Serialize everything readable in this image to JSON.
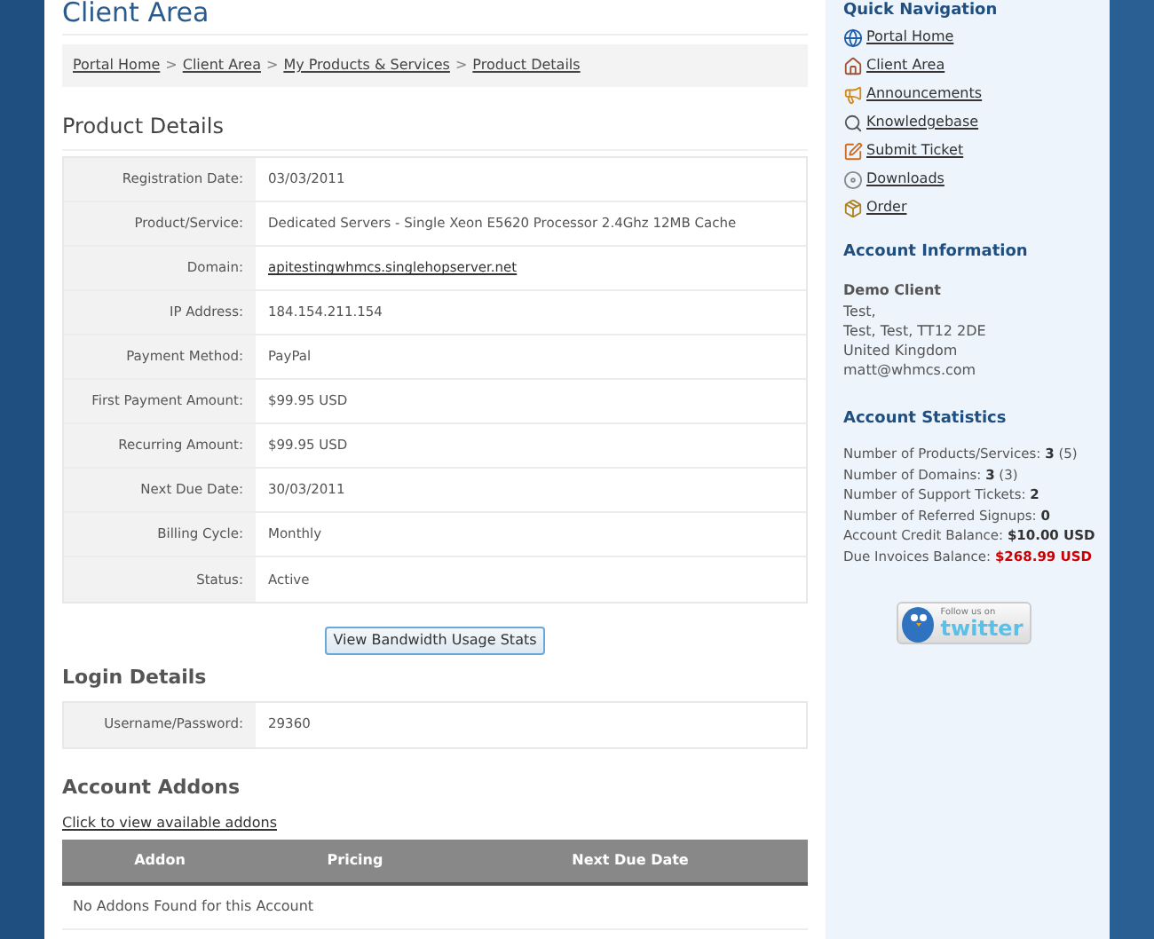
{
  "page_title": "Client Area",
  "breadcrumb": [
    "Portal Home",
    "Client Area",
    "My Products & Services",
    "Product Details"
  ],
  "breadcrumb_separator": ">",
  "product_details": {
    "title": "Product Details",
    "rows": [
      {
        "label": "Registration Date:",
        "value": "03/03/2011",
        "kind": "text"
      },
      {
        "label": "Product/Service:",
        "value": "Dedicated Servers - Single Xeon E5620 Processor 2.4Ghz 12MB Cache",
        "kind": "text"
      },
      {
        "label": "Domain:",
        "value": "apitestingwhmcs.singlehopserver.net",
        "kind": "link"
      },
      {
        "label": "IP Address:",
        "value": "184.154.211.154",
        "kind": "text"
      },
      {
        "label": "Payment Method:",
        "value": "PayPal",
        "kind": "text"
      },
      {
        "label": "First Payment Amount:",
        "value": "$99.95 USD",
        "kind": "text"
      },
      {
        "label": "Recurring Amount:",
        "value": "$99.95 USD",
        "kind": "text"
      },
      {
        "label": "Next Due Date:",
        "value": "30/03/2011",
        "kind": "text"
      },
      {
        "label": "Billing Cycle:",
        "value": "Monthly",
        "kind": "text"
      },
      {
        "label": "Status:",
        "value": "Active",
        "kind": "text"
      }
    ]
  },
  "bandwidth_button": "View Bandwidth Usage Stats",
  "login_details": {
    "title": "Login Details",
    "rows": [
      {
        "label": "Username/Password:",
        "value": "29360"
      }
    ]
  },
  "account_addons": {
    "title": "Account Addons",
    "link": "Click to view available addons",
    "columns": [
      "Addon",
      "Pricing",
      "Next Due Date"
    ],
    "empty_message": "No Addons Found for this Account"
  },
  "sidebar": {
    "quick_navigation": {
      "title": "Quick Navigation",
      "items": [
        {
          "label": "Portal Home",
          "kind": "globe"
        },
        {
          "label": "Client Area",
          "kind": "home"
        },
        {
          "label": "Announcements",
          "kind": "megaphone"
        },
        {
          "label": "Knowledgebase",
          "kind": "search"
        },
        {
          "label": "Submit Ticket",
          "kind": "pencil"
        },
        {
          "label": "Downloads",
          "kind": "disc"
        },
        {
          "label": "Order",
          "kind": "box"
        }
      ]
    },
    "account_information": {
      "title": "Account Information",
      "name": "Demo Client",
      "lines": [
        "Test,",
        "Test, Test, TT12 2DE",
        "United Kingdom",
        "matt@whmcs.com"
      ]
    },
    "account_statistics": {
      "title": "Account Statistics",
      "items": [
        {
          "label": "Number of Products/Services:",
          "value": "3",
          "note": "(5)",
          "kind": "normal"
        },
        {
          "label": "Number of Domains:",
          "value": "3",
          "note": "(3)",
          "kind": "normal"
        },
        {
          "label": "Number of Support Tickets:",
          "value": "2",
          "kind": "normal"
        },
        {
          "label": "Number of Referred Signups:",
          "value": "0",
          "kind": "normal"
        },
        {
          "label": "Account Credit Balance:",
          "value": "$10.00 USD",
          "kind": "normal"
        },
        {
          "label": "Due Invoices Balance:",
          "value": "$268.99 USD",
          "kind": "due"
        }
      ]
    },
    "twitter_badge": {
      "caption": "Follow us on",
      "brand": "twitter"
    }
  }
}
